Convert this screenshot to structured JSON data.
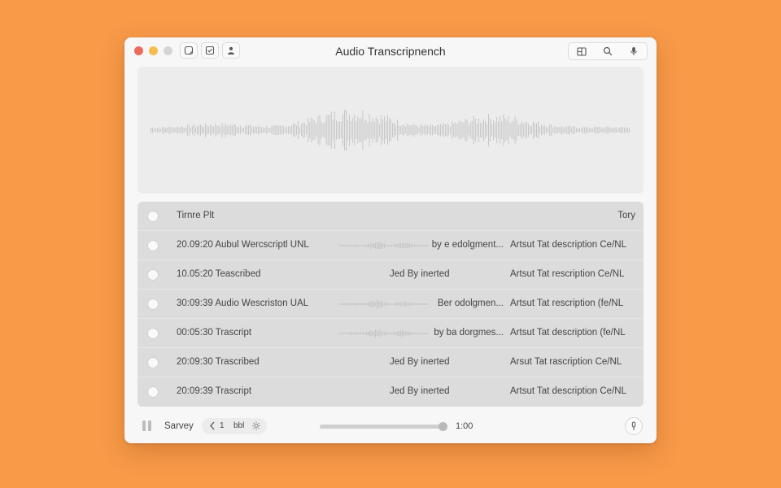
{
  "window": {
    "title": "Audio Transcripnench"
  },
  "toolbar": {
    "left_icons": [
      "note-icon",
      "checklist-icon",
      "person-icon"
    ],
    "right_icons": [
      "layout-icon",
      "search-icon",
      "microphone-icon"
    ]
  },
  "table": {
    "header": {
      "main": "Tirnre Plt",
      "right": "Tory"
    },
    "rows": [
      {
        "main": "20.09:20 Aubul Wercscriptl UNL",
        "mid": "by e edolgment...",
        "has_wave": true,
        "desc": "Artsut Tat description Ce/NL"
      },
      {
        "main": "10.05:20 Teascribed",
        "mid": "Jed By inerted",
        "has_wave": false,
        "desc": "Artsut Tat rescription Ce/NL"
      },
      {
        "main": "30:09:39 Audio Wescriston UAL",
        "mid": "Ber odolgmen...",
        "has_wave": true,
        "desc": "Artsut Tat rescription (fe/NL"
      },
      {
        "main": "00:05:30 Trascript",
        "mid": "by ba dorgmes...",
        "has_wave": true,
        "desc": "Artsut Tat description (fe/NL"
      },
      {
        "main": "20:09:30 Trascribed",
        "mid": "Jed By inerted",
        "has_wave": false,
        "desc": "Arsut Tat rascription Ce/NL"
      },
      {
        "main": "20:09:39 Trascript",
        "mid": "Jed By inerted",
        "has_wave": false,
        "desc": "Artsut Tat description Ce/NL"
      }
    ]
  },
  "footer": {
    "speed_label": "Sarvey",
    "pager_number": "1",
    "pager_label": "bbl",
    "time": "1:00",
    "progress_fraction": 0.98
  },
  "colors": {
    "background": "#f89a48",
    "window": "#f7f7f7",
    "wave": "#bdbdbd"
  }
}
